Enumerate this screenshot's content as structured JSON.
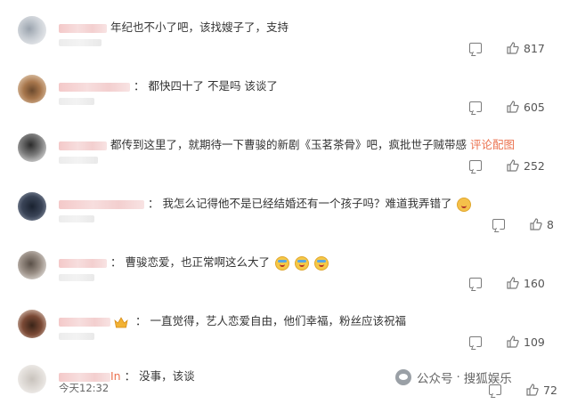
{
  "comments": [
    {
      "text": "年纪也不小了吧，该找嫂子了，支持",
      "likes": "817",
      "name_prefix": "",
      "prefix_colon": ""
    },
    {
      "text": "都快四十了 不是吗 该谈了",
      "likes": "605",
      "prefix_colon": "："
    },
    {
      "text": "都传到这里了，就期待一下曹骏的新剧《玉茗茶骨》吧，疯批世子贼带感",
      "link": "评论配图",
      "likes": "252",
      "prefix_colon": ""
    },
    {
      "text": "我怎么记得他不是已经结婚还有一个孩子吗？难道我弄错了",
      "likes": "8",
      "prefix_colon": "："
    },
    {
      "text": "曹骏恋爱，也正常啊这么大了",
      "likes": "160",
      "prefix_colon": "："
    },
    {
      "text": "一直觉得，艺人恋爱自由，他们幸福，粉丝应该祝福",
      "likes": "109",
      "prefix_colon": "："
    },
    {
      "name_suffix": "In",
      "text": "没事，该谈",
      "likes": "72",
      "prefix_colon": "："
    }
  ],
  "timestamp": "今天12:32",
  "watermark": {
    "platform": "公众号",
    "separator": "·",
    "account": "搜狐娱乐"
  },
  "icons": {
    "reply": "comment-icon",
    "like": "thumbs-up-icon",
    "emoji": "laugh-cry-emoji",
    "cry": "crying-emoji",
    "badge": "crown-badge-icon"
  },
  "colors": {
    "link": "#eb7350",
    "name_blur": "#f4c9c9",
    "text": "#333333"
  }
}
